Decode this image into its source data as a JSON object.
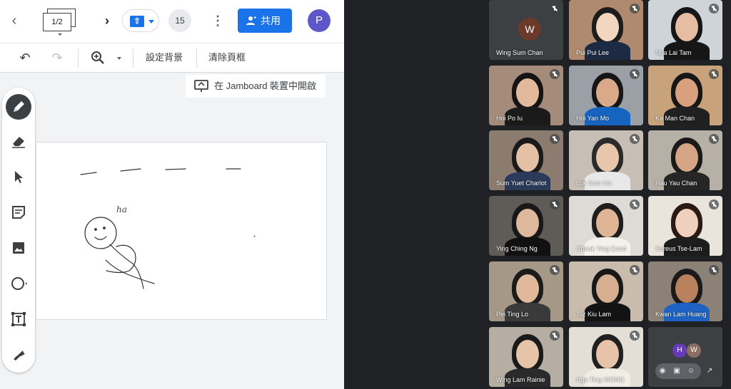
{
  "jamboard": {
    "frame_counter": "1/2",
    "participant_count": "15",
    "share_label": "共用",
    "avatar_letter": "P",
    "toolbar": {
      "set_background": "設定背景",
      "clear_frame": "清除頁框"
    },
    "open_in_jamboard": "在 Jamboard 裝置中開啟",
    "canvas_text": "ha"
  },
  "meet": {
    "tiles": [
      {
        "name": "Wing Sum Chan",
        "avatar": "W"
      },
      {
        "name": "Pui Pui Lee"
      },
      {
        "name": "Nga Lai Tam"
      },
      {
        "name": "Hoi Po Iu"
      },
      {
        "name": "Hoi Yan Mo"
      },
      {
        "name": "Ka Man Chan"
      },
      {
        "name": "Sum Yuet Charlot"
      },
      {
        "name": "Lok Sum Ho"
      },
      {
        "name": "Hau Yau Chan"
      },
      {
        "name": "Ying Ching Ng"
      },
      {
        "name": "Cheuk Ying Cand"
      },
      {
        "name": "Sereus Tse-Lam"
      },
      {
        "name": "Pei Ting Lo"
      },
      {
        "name": "Tsz Kiu Lam"
      },
      {
        "name": "Kwan Lam Huang"
      },
      {
        "name": "Wing Lam Rainie"
      },
      {
        "name": "Nga Ting WONG"
      }
    ],
    "last_tile": {
      "avatars": [
        "H",
        "W"
      ],
      "avatar_colors": [
        "#673ab7",
        "#8d6e63"
      ]
    }
  }
}
